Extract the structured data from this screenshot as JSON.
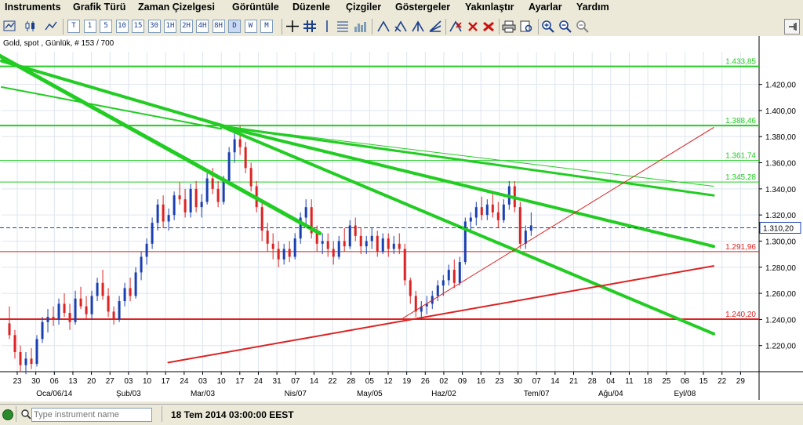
{
  "menu": [
    "Instruments",
    "Grafik Türü",
    "Zaman Çizelgesi",
    "Görüntüle",
    "Düzenle",
    "Çizgiler",
    "Göstergeler",
    "Yakınlaştır",
    "Ayarlar",
    "Yardım"
  ],
  "timeframes": [
    "T",
    "1",
    "5",
    "10",
    "15",
    "30",
    "1H",
    "2H",
    "4H",
    "8H",
    "D",
    "W",
    "M"
  ],
  "chart": {
    "title": "Gold, spot , Günlük, # 153 / 700"
  },
  "chart_data": {
    "type": "candlestick",
    "instrument": "Gold, spot",
    "y_range": [
      1200,
      1445
    ],
    "y_ticks": [
      1220,
      1240,
      1260,
      1280,
      1300,
      1320,
      1340,
      1360,
      1380,
      1400,
      1420
    ],
    "y_tick_labels": [
      "1.220,00",
      "1.240,00",
      "1.260,00",
      "1.280,00",
      "1.300,00",
      "1.320,00",
      "1.340,00",
      "1.360,00",
      "1.380,00",
      "1.400,00",
      "1.420,00"
    ],
    "x_day_labels": [
      "23",
      "30",
      "06",
      "13",
      "20",
      "27",
      "03",
      "10",
      "17",
      "24",
      "03",
      "10",
      "17",
      "24",
      "31",
      "07",
      "14",
      "22",
      "28",
      "05",
      "12",
      "19",
      "26",
      "02",
      "09",
      "16",
      "23",
      "30",
      "07",
      "14",
      "21",
      "28",
      "04",
      "11",
      "18",
      "25",
      "08",
      "15",
      "22",
      "29"
    ],
    "x_month_labels": [
      "Oca/06/14",
      "Şub/03",
      "Mar/03",
      "Nis/07",
      "May/05",
      "Haz/02",
      "Tem/07",
      "Ağu/04",
      "Eyl/08"
    ],
    "last_price_label": "1.310,20",
    "last_price": 1310.2,
    "horizontal_levels": [
      {
        "value": 1433.85,
        "label": "1.433,85",
        "color": "#22cc22"
      },
      {
        "value": 1388.46,
        "label": "1.388,46",
        "color": "#22cc22"
      },
      {
        "value": 1361.74,
        "label": "1.361,74",
        "color": "#22cc22"
      },
      {
        "value": 1345.28,
        "label": "1.345,28",
        "color": "#22cc22"
      },
      {
        "value": 1291.96,
        "label": "1.291,96",
        "color": "#dd2222"
      },
      {
        "value": 1240.2,
        "label": "1.240,20",
        "color": "#dd2222"
      }
    ],
    "ohlc": [
      [
        1237,
        1250,
        1225,
        1228
      ],
      [
        1228,
        1232,
        1210,
        1215
      ],
      [
        1215,
        1220,
        1200,
        1205
      ],
      [
        1205,
        1215,
        1198,
        1210
      ],
      [
        1210,
        1218,
        1202,
        1206
      ],
      [
        1206,
        1228,
        1204,
        1225
      ],
      [
        1225,
        1242,
        1222,
        1238
      ],
      [
        1238,
        1248,
        1230,
        1242
      ],
      [
        1242,
        1250,
        1235,
        1240
      ],
      [
        1240,
        1256,
        1236,
        1252
      ],
      [
        1252,
        1260,
        1242,
        1245
      ],
      [
        1245,
        1252,
        1232,
        1238
      ],
      [
        1238,
        1262,
        1236,
        1256
      ],
      [
        1256,
        1265,
        1248,
        1250
      ],
      [
        1250,
        1258,
        1240,
        1244
      ],
      [
        1244,
        1262,
        1240,
        1258
      ],
      [
        1258,
        1272,
        1254,
        1268
      ],
      [
        1268,
        1278,
        1255,
        1258
      ],
      [
        1258,
        1264,
        1242,
        1246
      ],
      [
        1246,
        1250,
        1236,
        1240
      ],
      [
        1240,
        1258,
        1238,
        1254
      ],
      [
        1254,
        1268,
        1250,
        1264
      ],
      [
        1264,
        1272,
        1254,
        1258
      ],
      [
        1258,
        1280,
        1256,
        1276
      ],
      [
        1276,
        1292,
        1270,
        1288
      ],
      [
        1288,
        1302,
        1282,
        1298
      ],
      [
        1298,
        1318,
        1294,
        1314
      ],
      [
        1314,
        1332,
        1308,
        1328
      ],
      [
        1328,
        1335,
        1310,
        1315
      ],
      [
        1315,
        1325,
        1308,
        1320
      ],
      [
        1320,
        1338,
        1316,
        1335
      ],
      [
        1335,
        1345,
        1328,
        1332
      ],
      [
        1332,
        1340,
        1318,
        1322
      ],
      [
        1322,
        1344,
        1318,
        1340
      ],
      [
        1340,
        1346,
        1322,
        1326
      ],
      [
        1326,
        1336,
        1318,
        1330
      ],
      [
        1330,
        1352,
        1328,
        1348
      ],
      [
        1348,
        1356,
        1336,
        1340
      ],
      [
        1340,
        1346,
        1326,
        1330
      ],
      [
        1330,
        1350,
        1328,
        1346
      ],
      [
        1346,
        1372,
        1344,
        1368
      ],
      [
        1368,
        1384,
        1360,
        1378
      ],
      [
        1378,
        1388,
        1366,
        1372
      ],
      [
        1372,
        1376,
        1352,
        1356
      ],
      [
        1356,
        1360,
        1338,
        1342
      ],
      [
        1342,
        1346,
        1322,
        1326
      ],
      [
        1326,
        1330,
        1300,
        1308
      ],
      [
        1308,
        1314,
        1292,
        1298
      ],
      [
        1298,
        1306,
        1286,
        1294
      ],
      [
        1294,
        1300,
        1280,
        1286
      ],
      [
        1286,
        1298,
        1282,
        1294
      ],
      [
        1294,
        1300,
        1284,
        1288
      ],
      [
        1288,
        1306,
        1286,
        1302
      ],
      [
        1302,
        1322,
        1298,
        1318
      ],
      [
        1318,
        1332,
        1312,
        1326
      ],
      [
        1326,
        1332,
        1302,
        1306
      ],
      [
        1306,
        1312,
        1292,
        1298
      ],
      [
        1298,
        1306,
        1290,
        1300
      ],
      [
        1300,
        1306,
        1288,
        1294
      ],
      [
        1294,
        1300,
        1282,
        1288
      ],
      [
        1288,
        1304,
        1286,
        1300
      ],
      [
        1300,
        1310,
        1292,
        1296
      ],
      [
        1296,
        1316,
        1294,
        1312
      ],
      [
        1312,
        1318,
        1300,
        1304
      ],
      [
        1304,
        1310,
        1290,
        1296
      ],
      [
        1296,
        1304,
        1290,
        1300
      ],
      [
        1300,
        1310,
        1294,
        1304
      ],
      [
        1304,
        1308,
        1288,
        1292
      ],
      [
        1292,
        1306,
        1290,
        1302
      ],
      [
        1302,
        1306,
        1288,
        1294
      ],
      [
        1294,
        1304,
        1290,
        1298
      ],
      [
        1298,
        1306,
        1290,
        1294
      ],
      [
        1294,
        1298,
        1266,
        1270
      ],
      [
        1270,
        1272,
        1252,
        1258
      ],
      [
        1258,
        1262,
        1242,
        1246
      ],
      [
        1246,
        1254,
        1240,
        1250
      ],
      [
        1250,
        1258,
        1244,
        1252
      ],
      [
        1252,
        1262,
        1248,
        1258
      ],
      [
        1258,
        1270,
        1254,
        1266
      ],
      [
        1266,
        1274,
        1258,
        1270
      ],
      [
        1270,
        1282,
        1266,
        1278
      ],
      [
        1278,
        1286,
        1264,
        1268
      ],
      [
        1268,
        1288,
        1266,
        1284
      ],
      [
        1284,
        1318,
        1282,
        1315
      ],
      [
        1315,
        1322,
        1308,
        1318
      ],
      [
        1318,
        1330,
        1312,
        1326
      ],
      [
        1326,
        1334,
        1316,
        1320
      ],
      [
        1320,
        1332,
        1316,
        1328
      ],
      [
        1328,
        1336,
        1318,
        1322
      ],
      [
        1322,
        1330,
        1310,
        1316
      ],
      [
        1316,
        1332,
        1314,
        1328
      ],
      [
        1328,
        1346,
        1324,
        1342
      ],
      [
        1342,
        1346,
        1322,
        1326
      ],
      [
        1326,
        1330,
        1294,
        1298
      ],
      [
        1298,
        1312,
        1294,
        1308
      ],
      [
        1308,
        1322,
        1304,
        1312
      ]
    ],
    "trendlines": [
      {
        "from": [
          -0.04,
          1454
        ],
        "to": [
          0.42,
          1306
        ],
        "color": "#22cc22",
        "width": 5
      },
      {
        "from": [
          0.0,
          1438
        ],
        "to": [
          0.3,
          1387
        ],
        "color": "#22cc22",
        "width": 4
      },
      {
        "from": [
          0.0,
          1418
        ],
        "to": [
          0.29,
          1386
        ],
        "color": "#22cc22",
        "width": 2
      },
      {
        "from": [
          0.29,
          1388
        ],
        "to": [
          0.94,
          1229
        ],
        "color": "#22cc22",
        "width": 4
      },
      {
        "from": [
          0.29,
          1388
        ],
        "to": [
          0.94,
          1296
        ],
        "color": "#22cc22",
        "width": 4
      },
      {
        "from": [
          0.29,
          1388
        ],
        "to": [
          0.94,
          1335
        ],
        "color": "#22cc22",
        "width": 3
      },
      {
        "from": [
          0.29,
          1388
        ],
        "to": [
          0.94,
          1342
        ],
        "color": "#22cc22",
        "width": 1
      },
      {
        "from": [
          0.22,
          1207
        ],
        "to": [
          0.94,
          1281
        ],
        "color": "#dd2222",
        "width": 2
      },
      {
        "from": [
          0.53,
          1241
        ],
        "to": [
          0.94,
          1387
        ],
        "color": "#dd2222",
        "width": 1
      }
    ],
    "candle_x_range": [
      0.0,
      0.696
    ]
  },
  "status": {
    "search_placeholder": "Type instrument name",
    "datetime": "18 Tem 2014 03:00:00 EEST"
  }
}
